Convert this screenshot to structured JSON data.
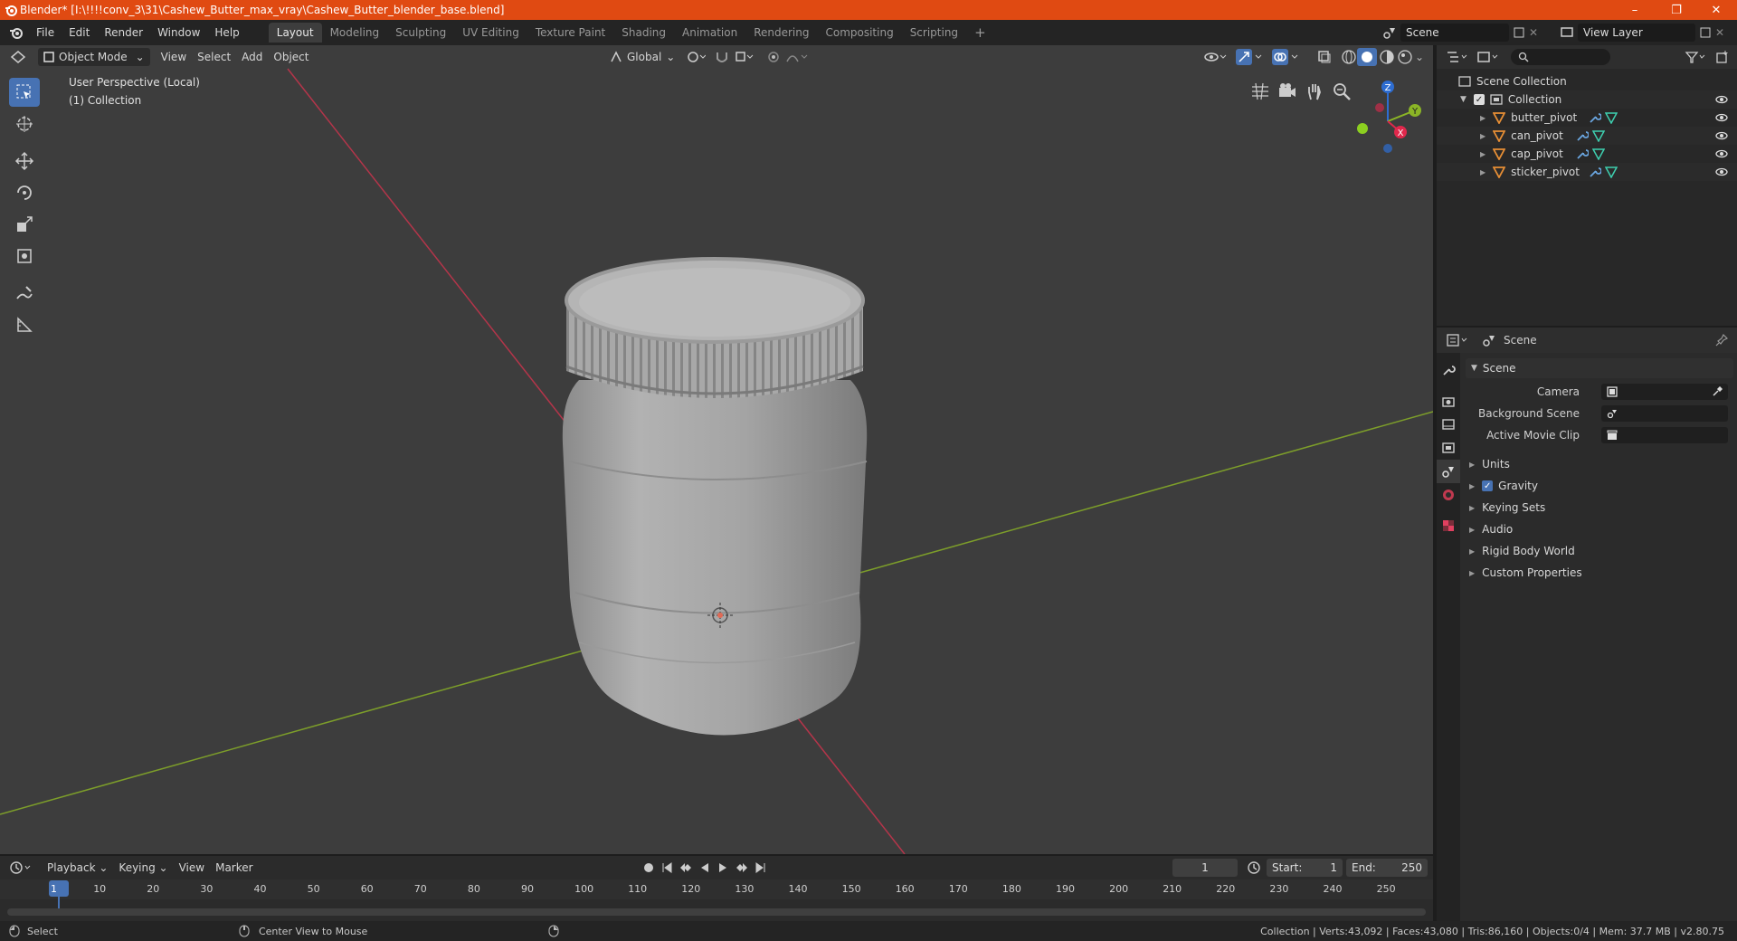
{
  "title": "Blender* [I:\\!!!!conv_3\\31\\Cashew_Butter_max_vray\\Cashew_Butter_blender_base.blend]",
  "window_controls": {
    "minimize": "–",
    "maximize": "❐",
    "close": "✕"
  },
  "menus": [
    "File",
    "Edit",
    "Render",
    "Window",
    "Help"
  ],
  "workspaces": [
    "Layout",
    "Modeling",
    "Sculpting",
    "UV Editing",
    "Texture Paint",
    "Shading",
    "Animation",
    "Rendering",
    "Compositing",
    "Scripting"
  ],
  "add_workspace": "+",
  "scene_field": "Scene",
  "view_layer_field": "View Layer",
  "viewport": {
    "mode": "Object Mode",
    "menus": [
      "View",
      "Select",
      "Add",
      "Object"
    ],
    "orientation": "Global",
    "overlay_line1": "User Perspective (Local)",
    "overlay_line2": "(1) Collection",
    "gizmo": {
      "z": "Z",
      "y": "Y",
      "x": "X"
    }
  },
  "outliner": {
    "root": "Scene Collection",
    "collection": "Collection",
    "items": [
      "butter_pivot",
      "can_pivot",
      "cap_pivot",
      "sticker_pivot"
    ]
  },
  "properties": {
    "header": "Scene",
    "section": "Scene",
    "fields": [
      {
        "label": "Camera"
      },
      {
        "label": "Background Scene"
      },
      {
        "label": "Active Movie Clip"
      }
    ],
    "panels": [
      "Units",
      "Gravity",
      "Keying Sets",
      "Audio",
      "Rigid Body World",
      "Custom Properties"
    ]
  },
  "timeline": {
    "menus": [
      "Playback",
      "Keying",
      "View",
      "Marker"
    ],
    "current_frame": "1",
    "start_label": "Start:",
    "start": "1",
    "end_label": "End:",
    "end": "250",
    "ticks": [
      "1",
      "10",
      "20",
      "30",
      "40",
      "50",
      "60",
      "70",
      "80",
      "90",
      "100",
      "110",
      "120",
      "130",
      "140",
      "150",
      "160",
      "170",
      "180",
      "190",
      "200",
      "210",
      "220",
      "230",
      "240",
      "250"
    ]
  },
  "statusbar": {
    "left": "Select",
    "middle": "Center View to Mouse",
    "right": "Collection | Verts:43,092 | Faces:43,080 | Tris:86,160 | Objects:0/4 | Mem: 37.7 MB | v2.80.75"
  },
  "colors": {
    "accent": "#4772b3",
    "titlebar": "#e04a12",
    "axis_x": "#c2304a",
    "axis_y": "#7a9c2a"
  }
}
